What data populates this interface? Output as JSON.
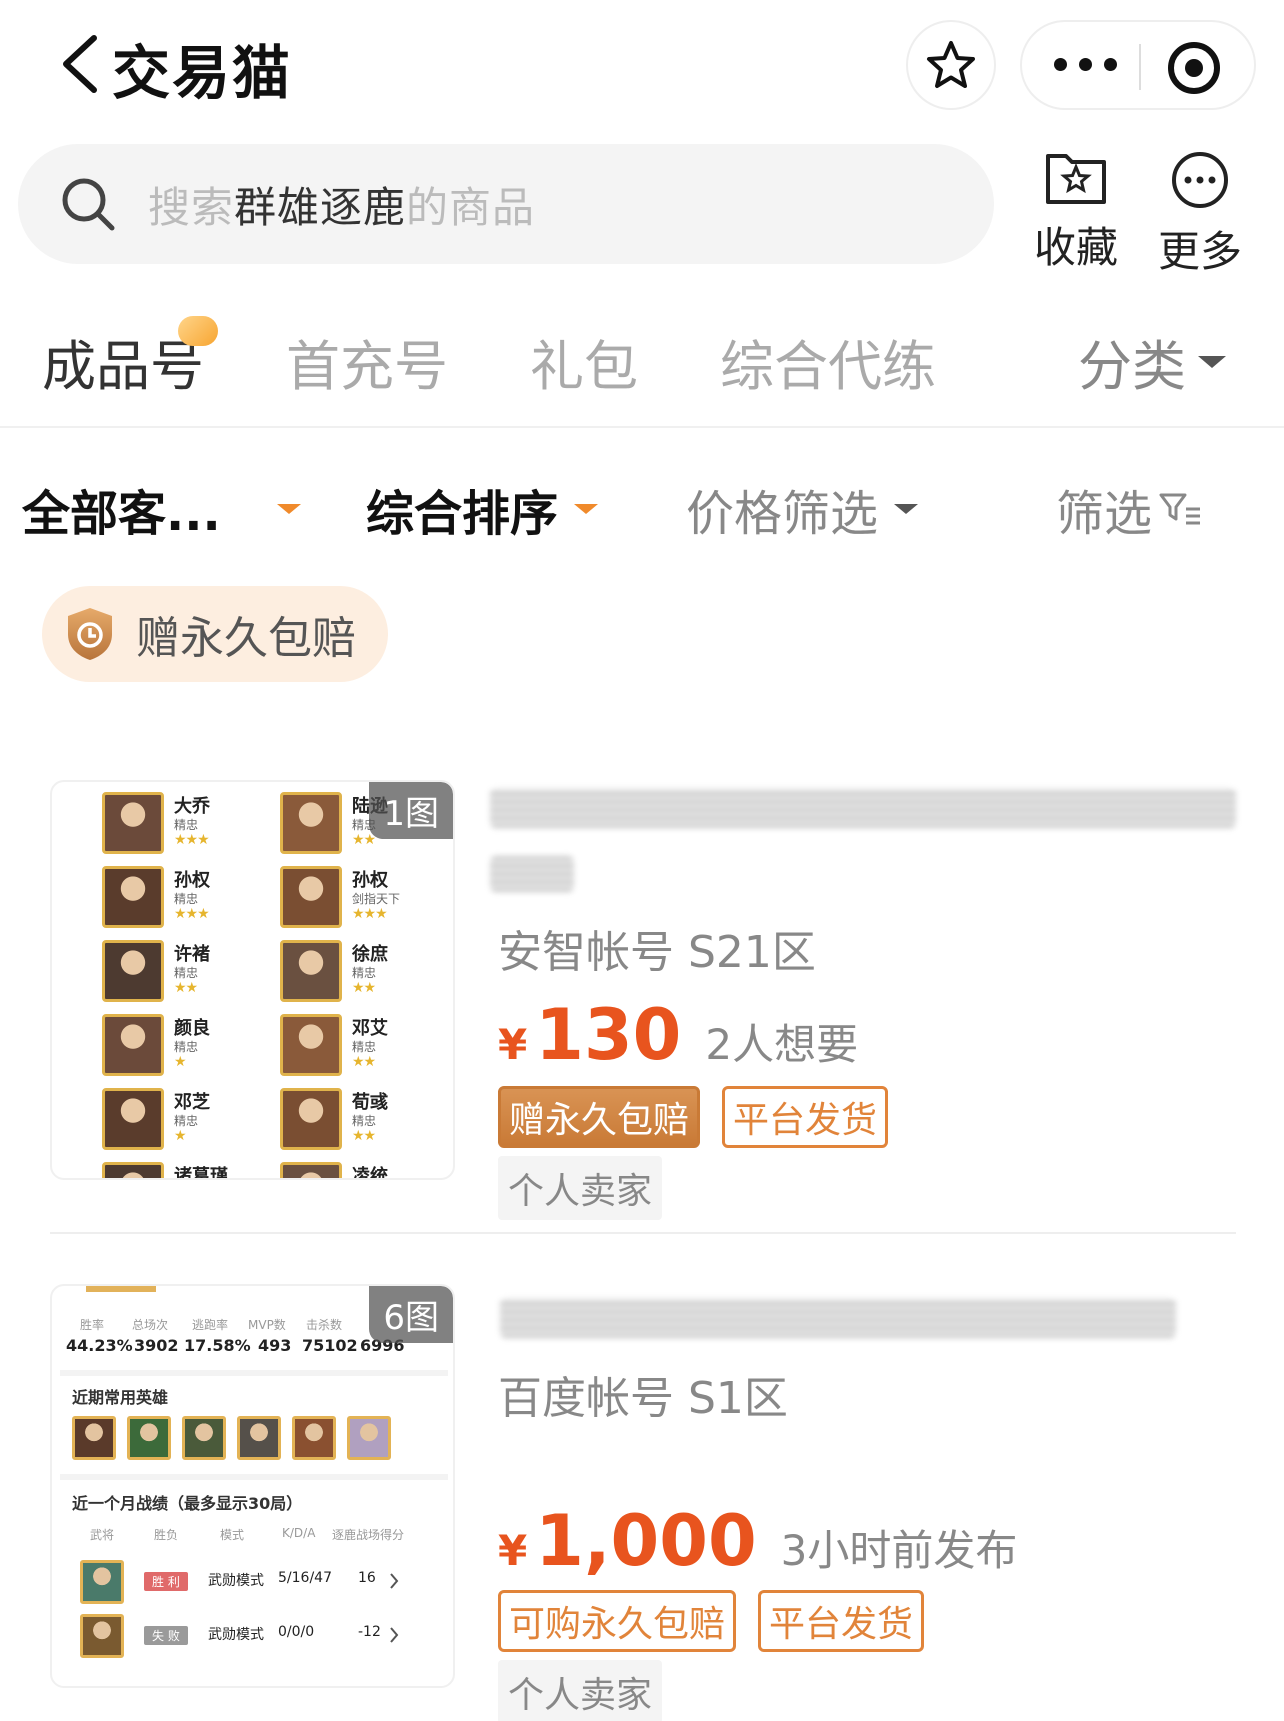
{
  "header": {
    "title": "交易猫"
  },
  "search": {
    "placeholder_prefix": "搜索",
    "keyword": "群雄逐鹿",
    "placeholder_suffix": "的商品"
  },
  "actions": {
    "favorite_label": "收藏",
    "more_label": "更多"
  },
  "category_tabs": [
    "成品号",
    "首充号",
    "礼包",
    "综合代练"
  ],
  "category_more": "分类",
  "filters": {
    "client": "全部客...",
    "sort": "综合排序",
    "price": "价格筛选",
    "filter": "筛选"
  },
  "promo": {
    "label": "赠永久包赔"
  },
  "listings": [
    {
      "image_count": "1图",
      "server": "安智帐号 S21区",
      "currency": "¥",
      "price": "130",
      "meta": "2人想要",
      "tags": [
        "赠永久包赔",
        "平台发货"
      ],
      "seller": "个人卖家",
      "thumb_heroes": [
        {
          "name": "大乔",
          "sub": "精忠",
          "stars": "★★★"
        },
        {
          "name": "陆逊",
          "sub": "精忠",
          "stars": "★★"
        },
        {
          "name": "孙权",
          "sub": "精忠",
          "stars": "★★★"
        },
        {
          "name": "孙权",
          "sub": "剑指天下",
          "stars": "★★★"
        },
        {
          "name": "许褚",
          "sub": "精忠",
          "stars": "★★"
        },
        {
          "name": "徐庶",
          "sub": "精忠",
          "stars": "★★"
        },
        {
          "name": "颜良",
          "sub": "精忠",
          "stars": "★"
        },
        {
          "name": "邓艾",
          "sub": "精忠",
          "stars": "★★"
        },
        {
          "name": "邓芝",
          "sub": "精忠",
          "stars": "★"
        },
        {
          "name": "荀彧",
          "sub": "精忠",
          "stars": "★★"
        },
        {
          "name": "诸葛瑾",
          "sub": "",
          "stars": ""
        },
        {
          "name": "凌统",
          "sub": "",
          "stars": ""
        }
      ]
    },
    {
      "image_count": "6图",
      "server": "百度帐号 S1区",
      "currency": "¥",
      "price": "1,000",
      "meta": "3小时前发布",
      "tags": [
        "可购永久包赔",
        "平台发货"
      ],
      "seller": "个人卖家",
      "thumb_stats": {
        "headers": [
          "胜率",
          "总场次",
          "逃跑率",
          "MVP数",
          "击杀数"
        ],
        "values": [
          "44.23%",
          "3902",
          "17.58%",
          "493",
          "75102",
          "6996"
        ],
        "recent_heroes_title": "近期常用英雄",
        "records_title": "近一个月战绩（最多显示30局）",
        "record_headers": [
          "武将",
          "胜负",
          "模式",
          "K/D/A",
          "逐鹿战场得分"
        ],
        "records": [
          {
            "result": "胜 利",
            "mode": "武勋模式",
            "kda": "5/16/47",
            "score": "16"
          },
          {
            "result": "失 败",
            "mode": "武勋模式",
            "kda": "0/0/0",
            "score": "-12"
          }
        ]
      }
    }
  ],
  "colors": {
    "accent": "#e8541e",
    "tag": "#e1843a",
    "promo_bg": "#fdeee0"
  }
}
